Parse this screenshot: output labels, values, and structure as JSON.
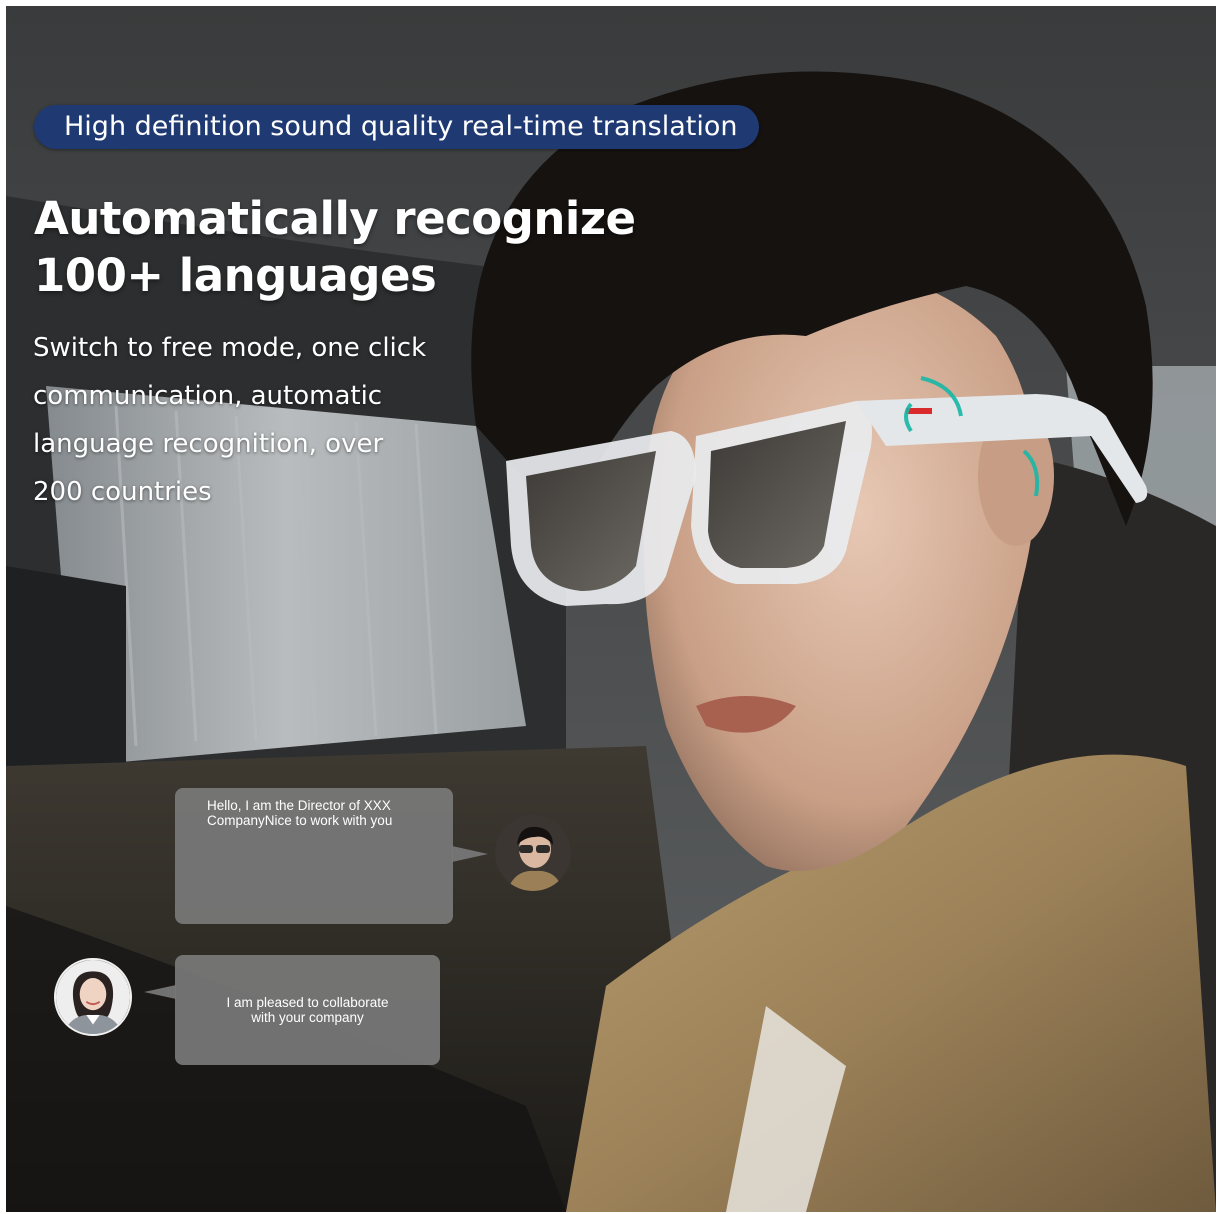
{
  "banner": {
    "text": "High definition sound quality real-time translation",
    "bg_color": "#1f3a73"
  },
  "headline": {
    "line1": "Automatically recognize",
    "line2": "100+ languages"
  },
  "subtext": {
    "line1": "Switch to free mode, one click",
    "line2": "communication, automatic",
    "line3": "language recognition, over",
    "line4": "200 countries"
  },
  "chat": {
    "bubble_1": {
      "line1": "Hello, I am the Director of XXX",
      "line2": "CompanyNice to work with you"
    },
    "bubble_2": {
      "line1": "I am pleased to collaborate",
      "line2": "with your company"
    },
    "bubble_color": "#787878"
  },
  "glasses": {
    "frame_color": "#e9ecef",
    "sound_wave_color": "#18b7a6"
  }
}
